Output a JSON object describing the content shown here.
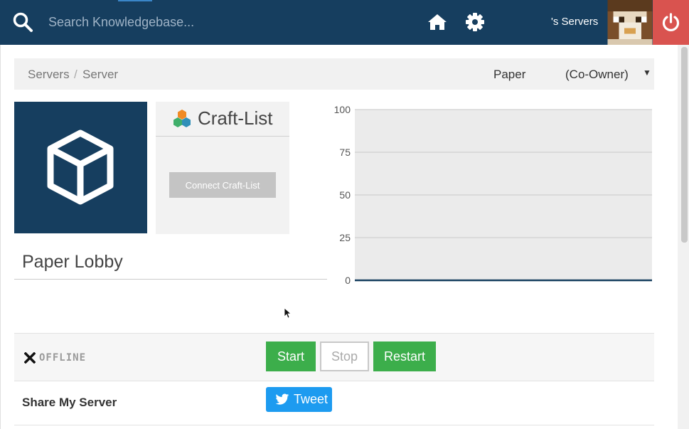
{
  "header": {
    "search_placeholder": "Search Knowledgebase...",
    "servers_link": "'s Servers",
    "icons": {
      "search": "search-icon",
      "home": "home-icon",
      "settings": "gear-icon",
      "power": "power-icon"
    },
    "colors": {
      "bar": "#163e5f",
      "power": "#d9534f"
    }
  },
  "breadcrumb": {
    "items": [
      "Servers",
      "Server"
    ],
    "separator": "/"
  },
  "server_select": {
    "name": "Paper",
    "role": "(Co-Owner)",
    "caret": "▼"
  },
  "craft_list": {
    "title": "Craft-List",
    "connect_label": "Connect Craft-List"
  },
  "server": {
    "title": "Paper Lobby",
    "status": "OFFLINE"
  },
  "controls": {
    "start": "Start",
    "stop": "Stop",
    "restart": "Restart",
    "colors": {
      "start": "#3cae4b",
      "restart": "#3cae4b"
    }
  },
  "share": {
    "label": "Share My Server",
    "tweet": "Tweet",
    "color": "#1d9bf0"
  },
  "chart_data": {
    "type": "area",
    "ylim": [
      0,
      100
    ],
    "yticks": [
      0,
      25,
      50,
      75,
      100
    ],
    "series": [
      {
        "values": [
          0,
          0
        ]
      }
    ],
    "grid": true
  }
}
